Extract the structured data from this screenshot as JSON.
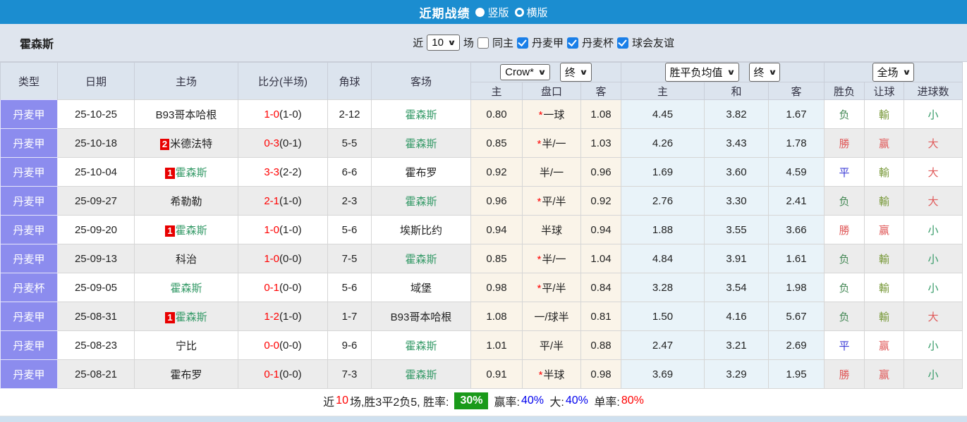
{
  "colors": {
    "top_bar": "#1b8dd0",
    "type_column": "#8c8cee",
    "team_green": "#339966",
    "score_red": "#ff0000",
    "result_red": "#e05a5a",
    "result_blue": "#3b3bd6",
    "win_rate_box": "#1a9a1a",
    "summary_blue": "#0000ee"
  },
  "header": {
    "title": "近期战绩",
    "radio_vertical": "竖版",
    "radio_horizontal": "横版"
  },
  "filter": {
    "team": "霍森斯",
    "near_label": "近",
    "matches_value": "10",
    "matches_suffix": "场",
    "same_home_label": "同主",
    "league_options": [
      "丹麦甲",
      "丹麦杯",
      "球会友谊"
    ]
  },
  "table": {
    "columns": [
      "类型",
      "日期",
      "主场",
      "比分(半场)",
      "角球",
      "客场"
    ],
    "dropdowns": {
      "crow": "Crow*",
      "final1": "终",
      "avg": "胜平负均值",
      "final2": "终",
      "scope": "全场"
    },
    "subheaders": [
      "主",
      "盘口",
      "客",
      "主",
      "和",
      "客",
      "胜负",
      "让球",
      "进球数"
    ],
    "rows": [
      {
        "type": "丹麦甲",
        "date": "25-10-25",
        "home": {
          "badge": "",
          "name": "B93哥本哈根",
          "green": false
        },
        "score": {
          "ft": "1-0",
          "ht": "(1-0)"
        },
        "corner": "2-12",
        "away": {
          "name": "霍森斯",
          "green": true
        },
        "crow": {
          "home": "0.80",
          "star": true,
          "handicap": "一球",
          "away": "1.08"
        },
        "avg": [
          "4.45",
          "3.82",
          "1.67"
        ],
        "results": {
          "wdl": "负",
          "let": "輸",
          "goal": "小"
        }
      },
      {
        "type": "丹麦甲",
        "date": "25-10-18",
        "home": {
          "badge": "2",
          "name": "米德法特",
          "green": false
        },
        "score": {
          "ft": "0-3",
          "ht": "(0-1)"
        },
        "corner": "5-5",
        "away": {
          "name": "霍森斯",
          "green": true
        },
        "crow": {
          "home": "0.85",
          "star": true,
          "handicap": "半/一",
          "away": "1.03"
        },
        "avg": [
          "4.26",
          "3.43",
          "1.78"
        ],
        "results": {
          "wdl": "勝",
          "let": "赢",
          "goal": "大"
        }
      },
      {
        "type": "丹麦甲",
        "date": "25-10-04",
        "home": {
          "badge": "1",
          "name": "霍森斯",
          "green": true
        },
        "score": {
          "ft": "3-3",
          "ht": "(2-2)"
        },
        "corner": "6-6",
        "away": {
          "name": "霍布罗",
          "green": false
        },
        "crow": {
          "home": "0.92",
          "star": false,
          "handicap": "半/一",
          "away": "0.96"
        },
        "avg": [
          "1.69",
          "3.60",
          "4.59"
        ],
        "results": {
          "wdl": "平",
          "let": "輸",
          "goal": "大"
        }
      },
      {
        "type": "丹麦甲",
        "date": "25-09-27",
        "home": {
          "badge": "",
          "name": "希勒勒",
          "green": false
        },
        "score": {
          "ft": "2-1",
          "ht": "(1-0)"
        },
        "corner": "2-3",
        "away": {
          "name": "霍森斯",
          "green": true
        },
        "crow": {
          "home": "0.96",
          "star": true,
          "handicap": "平/半",
          "away": "0.92"
        },
        "avg": [
          "2.76",
          "3.30",
          "2.41"
        ],
        "results": {
          "wdl": "负",
          "let": "輸",
          "goal": "大"
        }
      },
      {
        "type": "丹麦甲",
        "date": "25-09-20",
        "home": {
          "badge": "1",
          "name": "霍森斯",
          "green": true
        },
        "score": {
          "ft": "1-0",
          "ht": "(1-0)"
        },
        "corner": "5-6",
        "away": {
          "name": "埃斯比约",
          "green": false
        },
        "crow": {
          "home": "0.94",
          "star": false,
          "handicap": "半球",
          "away": "0.94"
        },
        "avg": [
          "1.88",
          "3.55",
          "3.66"
        ],
        "results": {
          "wdl": "勝",
          "let": "赢",
          "goal": "小"
        }
      },
      {
        "type": "丹麦甲",
        "date": "25-09-13",
        "home": {
          "badge": "",
          "name": "科治",
          "green": false
        },
        "score": {
          "ft": "1-0",
          "ht": "(0-0)"
        },
        "corner": "7-5",
        "away": {
          "name": "霍森斯",
          "green": true
        },
        "crow": {
          "home": "0.85",
          "star": true,
          "handicap": "半/一",
          "away": "1.04"
        },
        "avg": [
          "4.84",
          "3.91",
          "1.61"
        ],
        "results": {
          "wdl": "负",
          "let": "輸",
          "goal": "小"
        }
      },
      {
        "type": "丹麦杯",
        "date": "25-09-05",
        "home": {
          "badge": "",
          "name": "霍森斯",
          "green": true
        },
        "score": {
          "ft": "0-1",
          "ht": "(0-0)"
        },
        "corner": "5-6",
        "away": {
          "name": "域堡",
          "green": false
        },
        "crow": {
          "home": "0.98",
          "star": true,
          "handicap": "平/半",
          "away": "0.84"
        },
        "avg": [
          "3.28",
          "3.54",
          "1.98"
        ],
        "results": {
          "wdl": "负",
          "let": "輸",
          "goal": "小"
        }
      },
      {
        "type": "丹麦甲",
        "date": "25-08-31",
        "home": {
          "badge": "1",
          "name": "霍森斯",
          "green": true
        },
        "score": {
          "ft": "1-2",
          "ht": "(1-0)"
        },
        "corner": "1-7",
        "away": {
          "name": "B93哥本哈根",
          "green": false
        },
        "crow": {
          "home": "1.08",
          "star": false,
          "handicap": "一/球半",
          "away": "0.81"
        },
        "avg": [
          "1.50",
          "4.16",
          "5.67"
        ],
        "results": {
          "wdl": "负",
          "let": "輸",
          "goal": "大"
        }
      },
      {
        "type": "丹麦甲",
        "date": "25-08-23",
        "home": {
          "badge": "",
          "name": "宁比",
          "green": false
        },
        "score": {
          "ft": "0-0",
          "ht": "(0-0)"
        },
        "corner": "9-6",
        "away": {
          "name": "霍森斯",
          "green": true
        },
        "crow": {
          "home": "1.01",
          "star": false,
          "handicap": "平/半",
          "away": "0.88"
        },
        "avg": [
          "2.47",
          "3.21",
          "2.69"
        ],
        "results": {
          "wdl": "平",
          "let": "赢",
          "goal": "小"
        }
      },
      {
        "type": "丹麦甲",
        "date": "25-08-21",
        "home": {
          "badge": "",
          "name": "霍布罗",
          "green": false
        },
        "score": {
          "ft": "0-1",
          "ht": "(0-0)"
        },
        "corner": "7-3",
        "away": {
          "name": "霍森斯",
          "green": true
        },
        "crow": {
          "home": "0.91",
          "star": true,
          "handicap": "半球",
          "away": "0.98"
        },
        "avg": [
          "3.69",
          "3.29",
          "1.95"
        ],
        "results": {
          "wdl": "勝",
          "let": "赢",
          "goal": "小"
        }
      }
    ]
  },
  "summary": {
    "near_label": "近",
    "count": "10",
    "stats": "场,胜3平2负5, 胜率:",
    "win_rate": "30%",
    "win_pct_label": "赢率:",
    "win_pct": "40%",
    "big_label": "大:",
    "big_pct": "40%",
    "single_label": "单率:",
    "single_pct": "80%"
  }
}
